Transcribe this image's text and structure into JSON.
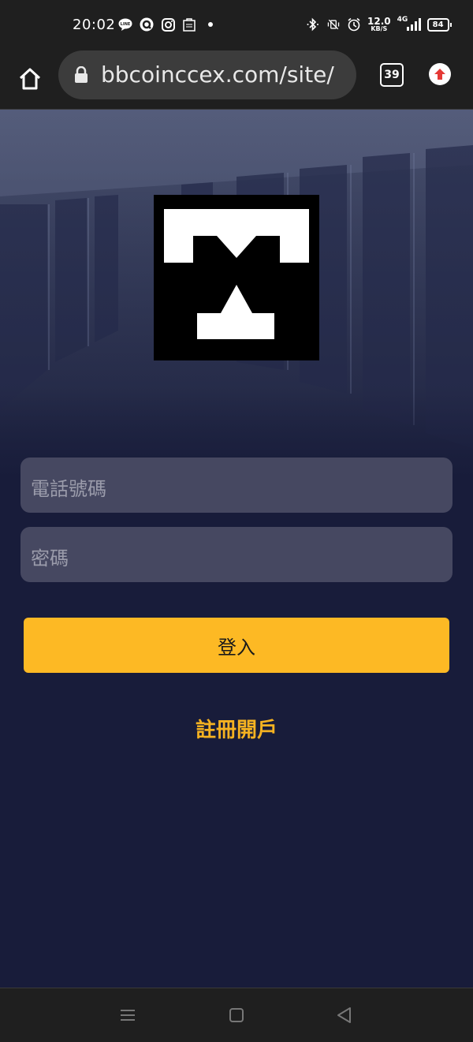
{
  "status_bar": {
    "time": "20:02",
    "net_speed_value": "12.0",
    "net_speed_unit": "KB/S",
    "network": "4G",
    "battery": "84",
    "left_icons": [
      "line-icon",
      "q-icon",
      "instagram-icon",
      "shopping-bag-icon",
      "dot-icon"
    ],
    "right_icons": [
      "bluetooth-icon",
      "vibrate-off-icon",
      "alarm-icon",
      "signal-icon"
    ]
  },
  "browser": {
    "url": "bbcoinccex.com/site/",
    "tab_count": "39"
  },
  "login": {
    "phone_placeholder": "電話號碼",
    "password_placeholder": "密碼",
    "login_label": "登入",
    "register_label": "註冊開戶"
  },
  "colors": {
    "background": "#181c3a",
    "field": "#464861",
    "accent": "#fdb924",
    "link": "#f5b221"
  }
}
